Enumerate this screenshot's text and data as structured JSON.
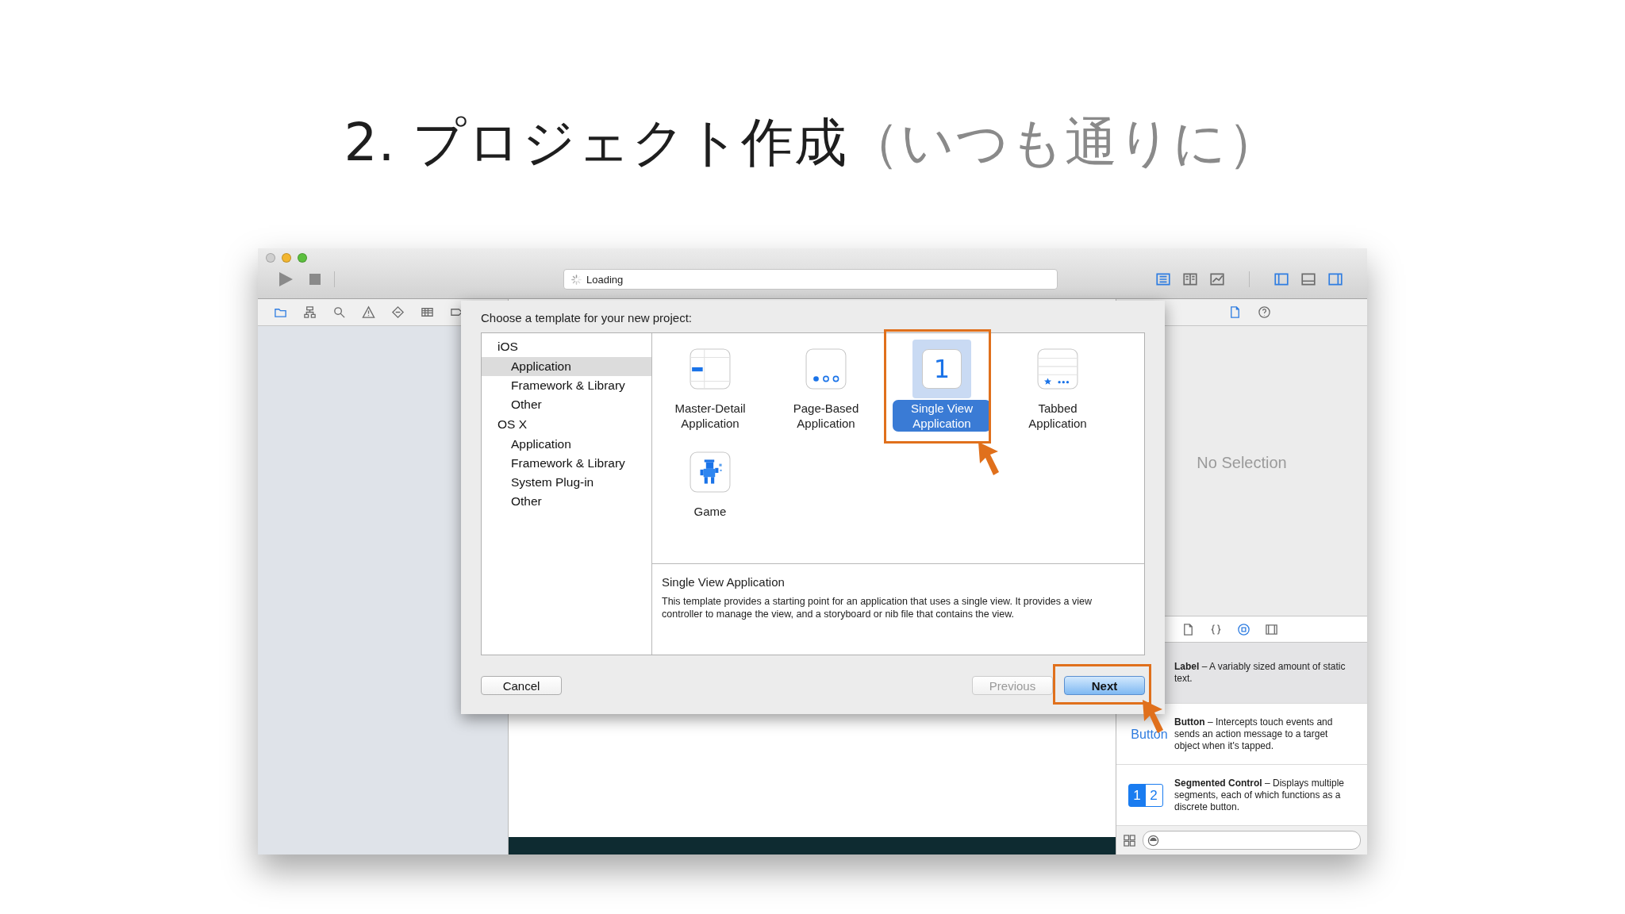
{
  "slide_title": {
    "main": "2. プロジェクト作成",
    "note": "（いつも通りに）"
  },
  "window": {
    "traffic_lights": [
      {
        "color": "#cfcfcf"
      },
      {
        "color": "#f2b630"
      },
      {
        "color": "#5cbf3e"
      }
    ],
    "activity": {
      "text": "Loading"
    },
    "editor_modes": [
      {
        "kind": "standard",
        "selected": true
      },
      {
        "kind": "assistant",
        "selected": false
      },
      {
        "kind": "version",
        "selected": false
      }
    ],
    "view_toggles": [
      {
        "kind": "navigator",
        "on": true
      },
      {
        "kind": "debug",
        "on": false
      },
      {
        "kind": "utilities",
        "on": true
      }
    ]
  },
  "navigator_tabs": [
    {
      "kind": "folder",
      "selected": true
    },
    {
      "kind": "symbols",
      "selected": false
    },
    {
      "kind": "search",
      "selected": false
    },
    {
      "kind": "issues",
      "selected": false
    },
    {
      "kind": "tests",
      "selected": false
    },
    {
      "kind": "debug",
      "selected": false
    },
    {
      "kind": "breakpoints",
      "selected": false
    }
  ],
  "inspector": {
    "tabs": [
      {
        "kind": "file",
        "selected": true
      },
      {
        "kind": "help",
        "selected": false
      }
    ],
    "empty_text": "No Selection"
  },
  "library": {
    "tabs": [
      {
        "kind": "file",
        "selected": false
      },
      {
        "kind": "code",
        "selected": false
      },
      {
        "kind": "object",
        "selected": true
      },
      {
        "kind": "media",
        "selected": false
      }
    ],
    "items": [
      {
        "kind": "label",
        "text": "**Label** – A variably sized amount of static text.",
        "selected": true
      },
      {
        "kind": "button",
        "preview_text": "Button",
        "text": "**Button** – Intercepts touch events and sends an action message to a target object when it's tapped.",
        "selected": false
      },
      {
        "kind": "segmented",
        "segments": [
          {
            "label": "1",
            "selected": true
          },
          {
            "label": "2",
            "selected": false
          }
        ],
        "text": "**Segmented Control** – Displays multiple segments, each of which functions as a discrete button.",
        "selected": false
      }
    ]
  },
  "dialog": {
    "title": "Choose a template for your new project:",
    "categories": [
      {
        "label": "iOS",
        "children": [
          {
            "label": "Application",
            "selected": true
          },
          {
            "label": "Framework & Library",
            "selected": false
          },
          {
            "label": "Other",
            "selected": false
          }
        ]
      },
      {
        "label": "OS X",
        "children": [
          {
            "label": "Application",
            "selected": false
          },
          {
            "label": "Framework & Library",
            "selected": false
          },
          {
            "label": "System Plug-in",
            "selected": false
          },
          {
            "label": "Other",
            "selected": false
          }
        ]
      }
    ],
    "templates": [
      {
        "kind": "master_detail",
        "label": "Master-Detail Application",
        "selected": false
      },
      {
        "kind": "page_based",
        "label": "Page-Based Application",
        "selected": false
      },
      {
        "kind": "single_view",
        "glyph": "1",
        "label": "Single View Application",
        "selected": true
      },
      {
        "kind": "tabbed",
        "label": "Tabbed Application",
        "selected": false
      },
      {
        "kind": "game",
        "label": "Game",
        "selected": false
      }
    ],
    "description": {
      "title": "Single View Application",
      "text": "This template provides a starting point for an application that uses a single view. It provides a view controller to manage the view, and a storyboard or nib file that contains the view."
    },
    "left_buttons": [
      {
        "label": "Cancel",
        "default": false,
        "disabled": false
      }
    ],
    "right_buttons": [
      {
        "label": "Previous",
        "default": false,
        "disabled": true
      },
      {
        "label": "Next",
        "default": true,
        "disabled": false
      }
    ]
  }
}
